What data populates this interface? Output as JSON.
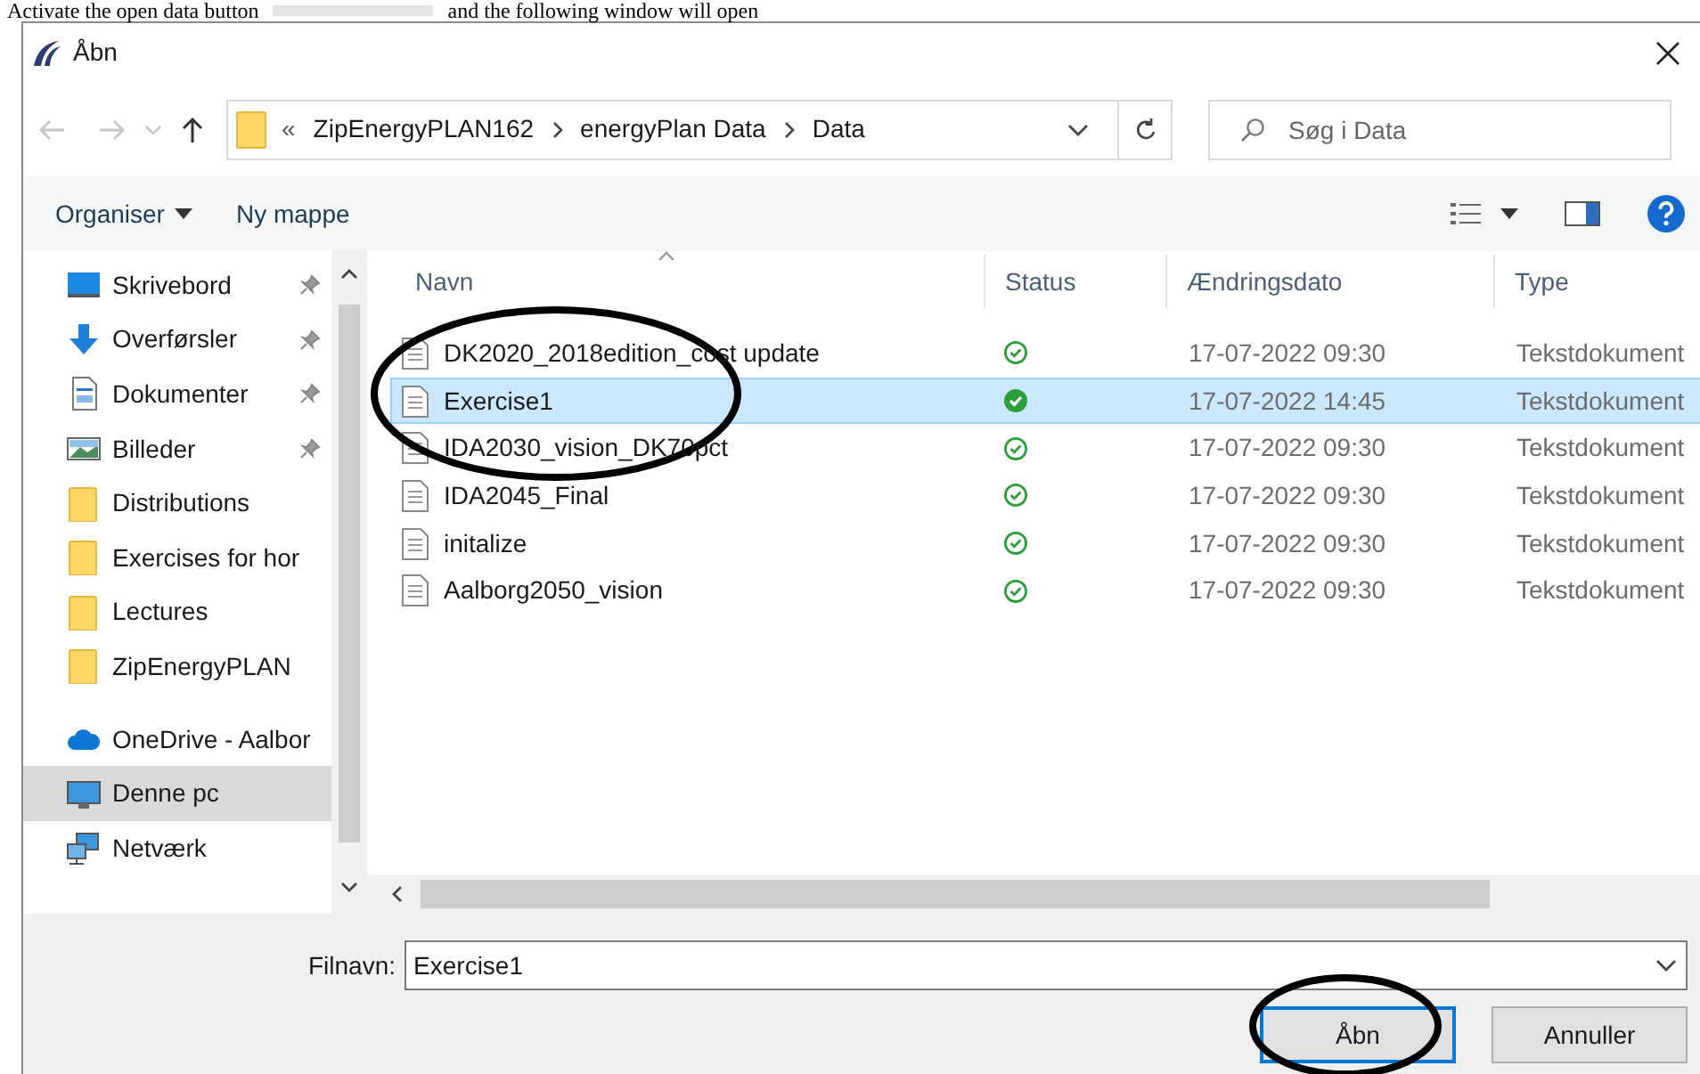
{
  "intro": {
    "before": "Activate the open data button",
    "after": "and the following window will open"
  },
  "window": {
    "title": "Åbn"
  },
  "address": {
    "overflow": "«",
    "crumbs": [
      "ZipEnergyPLAN162",
      "energyPlan Data",
      "Data"
    ]
  },
  "search": {
    "placeholder": "Søg i Data"
  },
  "toolbar": {
    "organise": "Organiser",
    "new_folder": "Ny mappe"
  },
  "sidebar": {
    "items": [
      {
        "label": "Skrivebord",
        "kind": "desktop",
        "pinned": true,
        "selected": false
      },
      {
        "label": "Overførsler",
        "kind": "download",
        "pinned": true,
        "selected": false
      },
      {
        "label": "Dokumenter",
        "kind": "document",
        "pinned": true,
        "selected": false
      },
      {
        "label": "Billeder",
        "kind": "pictures",
        "pinned": true,
        "selected": false
      },
      {
        "label": "Distributions",
        "kind": "folder",
        "pinned": false,
        "selected": false
      },
      {
        "label": "Exercises for hor",
        "kind": "folder",
        "pinned": false,
        "selected": false
      },
      {
        "label": "Lectures",
        "kind": "folder",
        "pinned": false,
        "selected": false
      },
      {
        "label": "ZipEnergyPLAN",
        "kind": "folder",
        "pinned": false,
        "selected": false
      },
      {
        "label": "OneDrive - Aalbor",
        "kind": "cloud",
        "pinned": false,
        "selected": false
      },
      {
        "label": "Denne pc",
        "kind": "pc",
        "pinned": false,
        "selected": true
      },
      {
        "label": "Netværk",
        "kind": "network",
        "pinned": false,
        "selected": false
      }
    ]
  },
  "table": {
    "columns": [
      "Navn",
      "Status",
      "Ændringsdato",
      "Type"
    ],
    "rows": [
      {
        "name": "DK2020_2018edition_cost update",
        "date": "17-07-2022 09:30",
        "type": "Tekstdokument",
        "selected": false
      },
      {
        "name": "Exercise1",
        "date": "17-07-2022 14:45",
        "type": "Tekstdokument",
        "selected": true
      },
      {
        "name": "IDA2030_vision_DK70pct",
        "date": "17-07-2022 09:30",
        "type": "Tekstdokument",
        "selected": false
      },
      {
        "name": "IDA2045_Final",
        "date": "17-07-2022 09:30",
        "type": "Tekstdokument",
        "selected": false
      },
      {
        "name": "initalize",
        "date": "17-07-2022 09:30",
        "type": "Tekstdokument",
        "selected": false
      },
      {
        "name": "Aalborg2050_vision",
        "date": "17-07-2022 09:30",
        "type": "Tekstdokument",
        "selected": false
      }
    ]
  },
  "filename": {
    "label": "Filnavn:",
    "value": "Exercise1"
  },
  "buttons": [
    {
      "label": "Åbn",
      "kind": "primary"
    },
    {
      "label": "Annuller",
      "kind": "secondary"
    }
  ]
}
